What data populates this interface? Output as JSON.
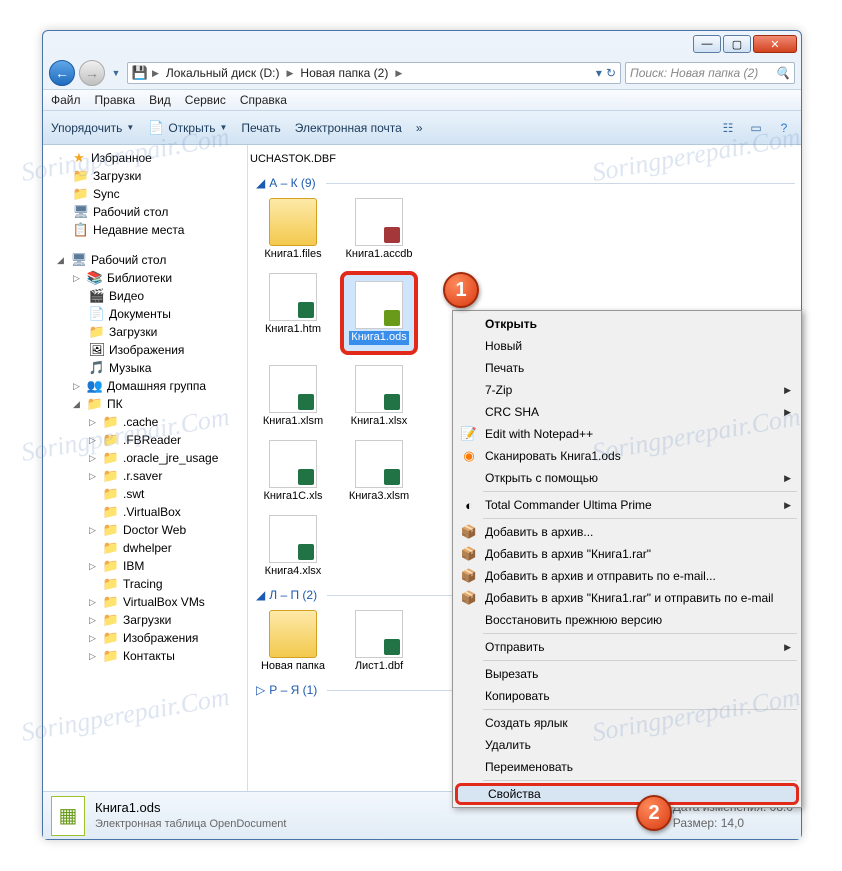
{
  "watermark": "Soringperepair.Com",
  "address": {
    "drive": "Локальный диск (D:)",
    "folder": "Новая папка (2)"
  },
  "search": {
    "placeholder": "Поиск: Новая папка (2)"
  },
  "menubar": [
    "Файл",
    "Правка",
    "Вид",
    "Сервис",
    "Справка"
  ],
  "toolbar": {
    "organize": "Упорядочить",
    "open": "Открыть",
    "print": "Печать",
    "email": "Электронная почта"
  },
  "sidebar": {
    "favorites": "Избранное",
    "fav_items": [
      "Загрузки",
      "Sync",
      "Рабочий стол",
      "Недавние места"
    ],
    "desktop": "Рабочий стол",
    "libraries": "Библиотеки",
    "lib_items": [
      "Видео",
      "Документы",
      "Загрузки",
      "Изображения",
      "Музыка"
    ],
    "homegroup": "Домашняя группа",
    "pc": "ПК",
    "pc_items": [
      ".cache",
      ".FBReader",
      ".oracle_jre_usage",
      ".r.saver",
      ".swt",
      ".VirtualBox",
      "Doctor Web",
      "dwhelper",
      "IBM",
      "Tracing",
      "VirtualBox VMs",
      "Загрузки",
      "Изображения",
      "Контакты"
    ]
  },
  "content": {
    "top_file": "UCHASTOK.DBF",
    "group_ak": "А – К (9)",
    "group_lp": "Л – П (2)",
    "group_ry": "Р – Я (1)",
    "files_ak": [
      "Книга1.files",
      "Книга1.accdb",
      "Книга1.htm",
      "Книга1.ods",
      "Книга1.xlsm",
      "Книга1.xlsx",
      "Книга1С.xls",
      "Книга3.xlsm",
      "Книга4.xlsx"
    ],
    "files_lp": [
      "Новая папка",
      "Лист1.dbf"
    ]
  },
  "context_menu": {
    "open": "Открыть",
    "new": "Новый",
    "print": "Печать",
    "sevenzip": "7-Zip",
    "crcsha": "CRC SHA",
    "notepadpp": "Edit with Notepad++",
    "scan": "Сканировать Книга1.ods",
    "openwith": "Открыть с помощью",
    "totalcmd": "Total Commander Ultima Prime",
    "addarchive": "Добавить в архив...",
    "addrar": "Добавить в архив \"Книга1.rar\"",
    "addemail": "Добавить в архив и отправить по e-mail...",
    "addraremail": "Добавить в архив \"Книга1.rar\" и отправить по e-mail",
    "restore": "Восстановить прежнюю версию",
    "sendto": "Отправить",
    "cut": "Вырезать",
    "copy": "Копировать",
    "shortcut": "Создать ярлык",
    "delete": "Удалить",
    "rename": "Переименовать",
    "properties": "Свойства"
  },
  "details": {
    "name": "Книга1.ods",
    "type": "Электронная таблица OpenDocument",
    "modified_label": "Дата изменения:",
    "modified": "08.0",
    "size_label": "Размер:",
    "size": "14,0"
  },
  "badges": {
    "one": "1",
    "two": "2"
  }
}
